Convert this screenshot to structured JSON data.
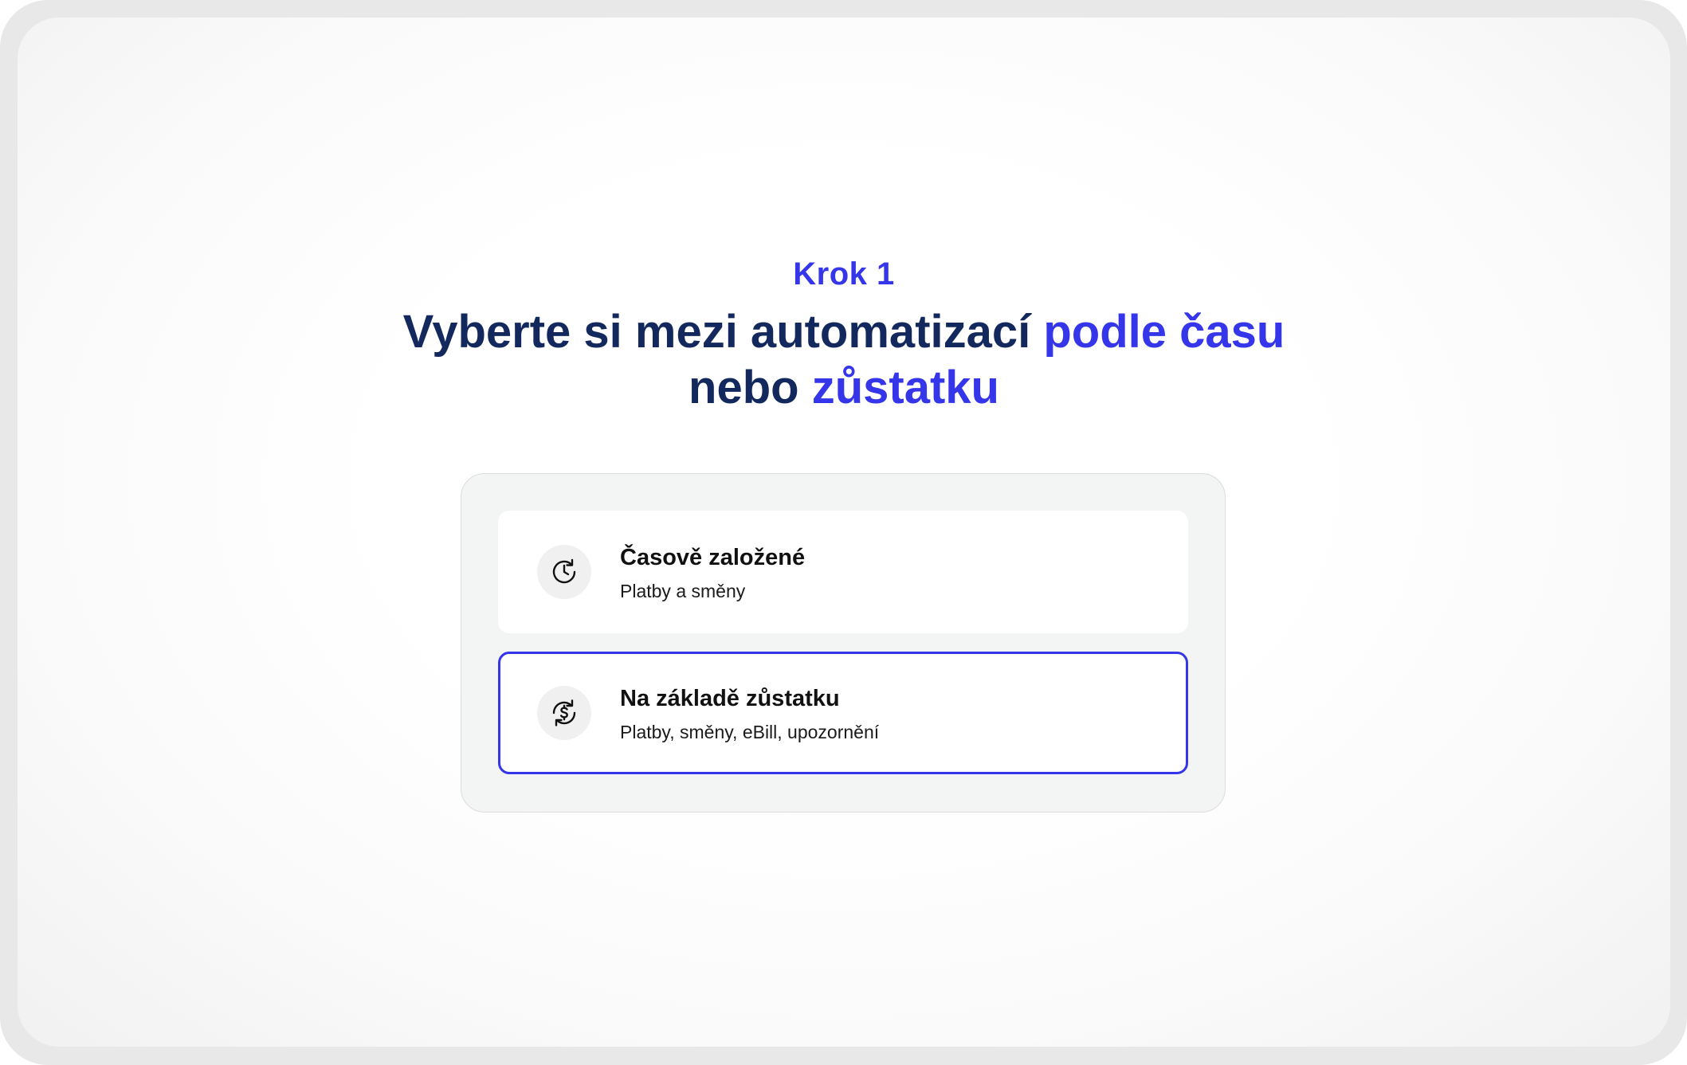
{
  "step": {
    "label": "Krok 1"
  },
  "heading": {
    "part1": "Vyberte si mezi automatizací ",
    "accent1": "podle času",
    "part2": "nebo ",
    "accent2": "zůstatku"
  },
  "options": [
    {
      "icon": "time-cycle-icon",
      "title": "Časově založené",
      "subtitle": "Platby a směny",
      "selected": false
    },
    {
      "icon": "balance-cycle-icon",
      "title": "Na základě zůstatku",
      "subtitle": "Platby, směny, eBill, upozornění",
      "selected": true
    }
  ],
  "colors": {
    "accent": "#3535ea",
    "heading": "#13295e",
    "panel": "#f3f4f4"
  }
}
